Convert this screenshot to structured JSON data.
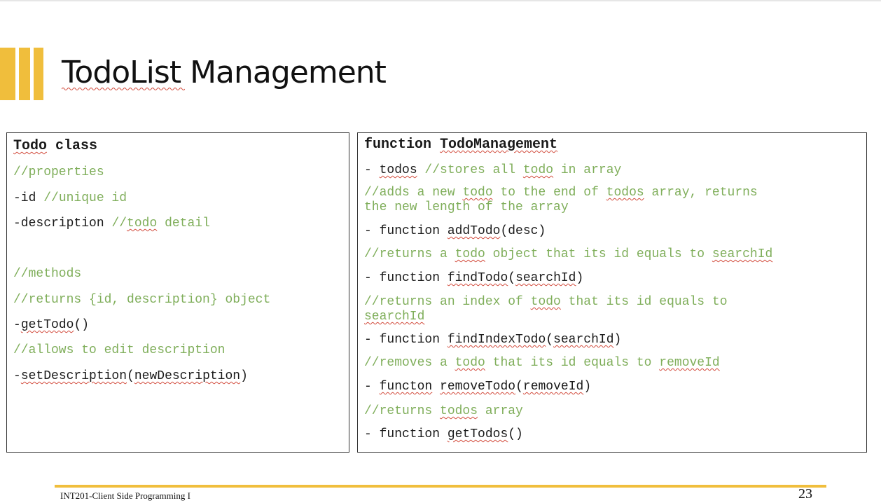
{
  "slide": {
    "title": "TodoList Management",
    "footer": "INT201-Client Side Programming I",
    "page_number": "23",
    "accent_color": "#f0be3c",
    "comment_color": "#7fae5a"
  },
  "todo_class": {
    "heading_word": "Todo",
    "heading_rest": " class",
    "properties_comment": "//properties",
    "id_code": "-id ",
    "id_comment": "//unique id",
    "desc_code": "-description ",
    "desc_comment_pre": "//",
    "desc_comment_word": "todo",
    "desc_comment_post": " detail",
    "methods_comment": "//methods",
    "returns_comment": "//returns {id, description} object",
    "get_dash": "-",
    "get_name": "getTodo",
    "get_args": "()",
    "edit_comment": "//allows to edit description",
    "set_dash": "-",
    "set_name": "setDescription",
    "set_paren_open": "(",
    "set_arg": "newDescription",
    "set_paren_close": ")"
  },
  "todo_management": {
    "heading_pre": "function ",
    "heading_name": "TodoManagement",
    "todos_dash": "- ",
    "todos_name": "todos",
    "todos_comment_pre": " //stores all ",
    "todos_comment_word": "todo",
    "todos_comment_post": " in array",
    "add_comment_1_pre": "//adds a new ",
    "add_comment_1_word1": "todo",
    "add_comment_1_mid": " to the end of ",
    "add_comment_1_word2": "todos",
    "add_comment_1_post": " array, returns",
    "add_comment_2": "the new length of the array",
    "add_pre": "- function ",
    "add_name": "addTodo",
    "add_args": "(desc)",
    "find_comment_pre": "//returns a ",
    "find_comment_word": "todo",
    "find_comment_mid": " object that its id equals to ",
    "find_comment_word2": "searchId",
    "find_pre": "- function ",
    "find_name": "findTodo",
    "find_paren_open": "(",
    "find_arg": "searchId",
    "find_paren_close": ")",
    "index_comment_1_pre": "//returns an index of ",
    "index_comment_1_word": "todo",
    "index_comment_1_post": " that its id equals to",
    "index_comment_2_word": "searchId",
    "index_pre": "- function ",
    "index_name": "findIndexTodo",
    "index_paren_open": "(",
    "index_arg": "searchId",
    "index_paren_close": ")",
    "remove_comment_pre": "//removes a ",
    "remove_comment_word": "todo",
    "remove_comment_mid": " that its id equals to ",
    "remove_comment_word2": "removeId",
    "remove_dash": "- ",
    "remove_keyword": "functon",
    "remove_space": " ",
    "remove_name": "removeTodo",
    "remove_paren_open": "(",
    "remove_arg": "removeId",
    "remove_paren_close": ")",
    "gettodos_comment_pre": "//returns ",
    "gettodos_comment_word": "todos",
    "gettodos_comment_post": " array",
    "gettodos_pre": "- function ",
    "gettodos_name": "getTodos",
    "gettodos_args": "()"
  }
}
